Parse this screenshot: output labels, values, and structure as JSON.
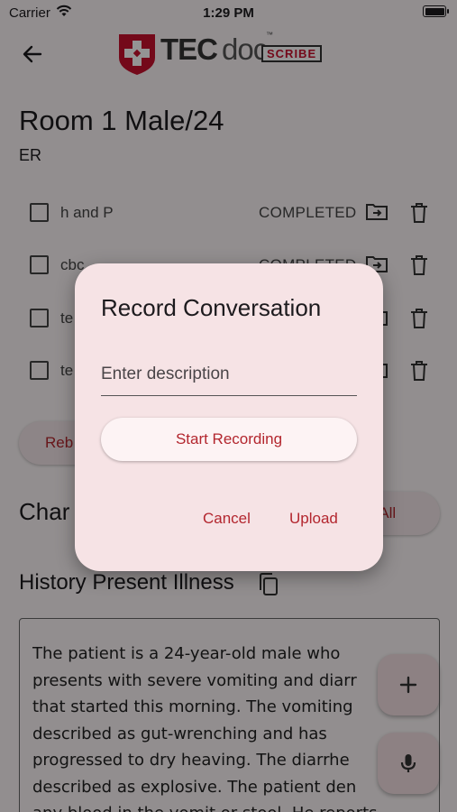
{
  "status_bar": {
    "carrier": "Carrier",
    "time": "1:29 PM"
  },
  "header": {
    "logo_tec": "TEC",
    "logo_doc": "doc",
    "logo_tm": "™",
    "logo_scribe": "SCRIBE"
  },
  "patient": {
    "room": "Room 1 Male/24",
    "department": "ER"
  },
  "orders": [
    {
      "name": "h and P",
      "status": "COMPLETED"
    },
    {
      "name": "cbc",
      "status": "COMPLETED"
    },
    {
      "name": "te",
      "status": ""
    },
    {
      "name": "te",
      "status": ""
    }
  ],
  "buttons": {
    "rebuild_label": "Reb",
    "copy_all_label": "y All"
  },
  "charts_heading": "Char",
  "hpi": {
    "title": "History Present Illness",
    "text": "The patient is a 24-year-old male who\npresents with severe vomiting and diarr\nthat started this morning. The vomiting\ndescribed as gut-wrenching and has\nprogressed to dry heaving. The diarrhe\ndescribed as explosive. The patient den\nany blood in the vomit or stool. He reports"
  },
  "dialog": {
    "title": "Record Conversation",
    "description_placeholder": "Enter description",
    "description_value": "",
    "start_recording_label": "Start Recording",
    "cancel_label": "Cancel",
    "upload_label": "Upload"
  },
  "colors": {
    "accent": "#b3262e",
    "logo_red": "#c8102e",
    "dialog_bg": "#f6e3e5",
    "fab_bg": "#f3dee2"
  },
  "icons": [
    "wifi-icon",
    "back-arrow-icon",
    "move-to-folder-icon",
    "trash-icon",
    "copy-icon",
    "plus-icon",
    "microphone-icon"
  ]
}
